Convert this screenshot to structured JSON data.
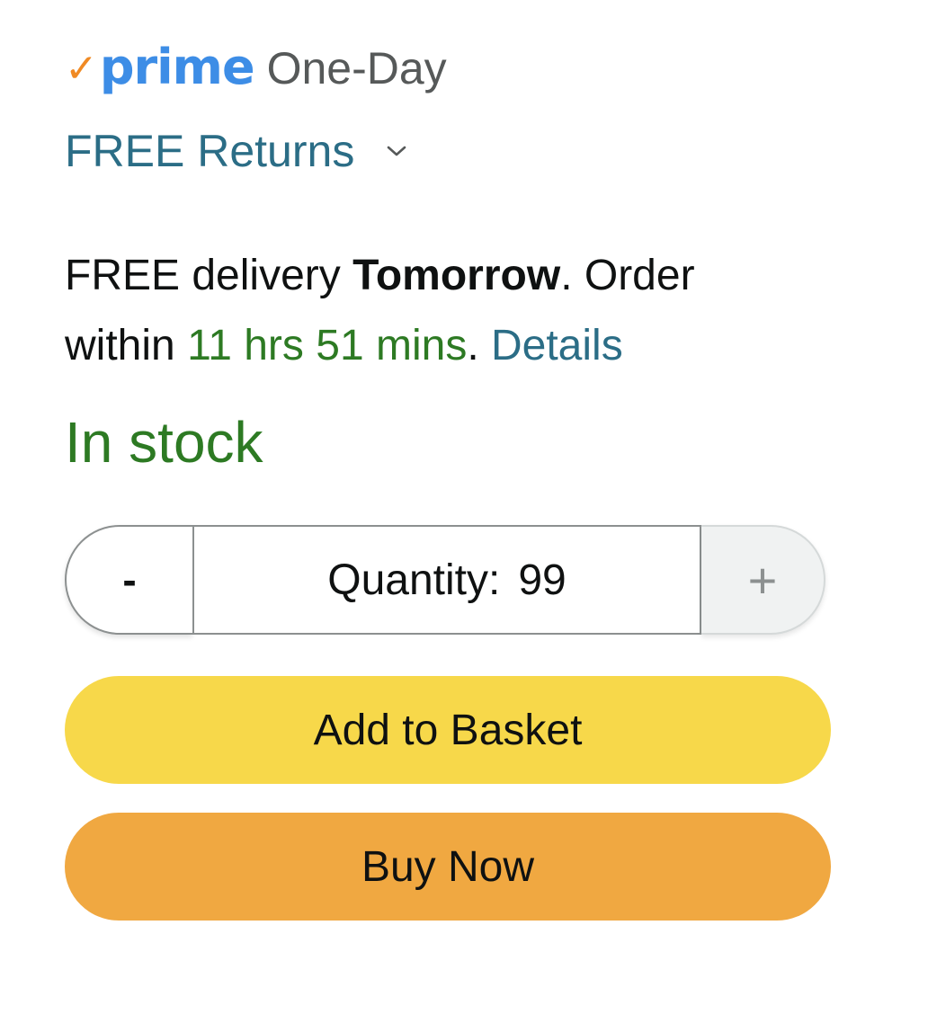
{
  "prime": {
    "check_glyph": "✓",
    "logo_word": "prime",
    "speed": "One-Day"
  },
  "returns": {
    "label": "FREE Returns",
    "chevron_icon": "chevron-down-icon"
  },
  "delivery": {
    "prefix": "FREE delivery ",
    "day": "Tomorrow",
    "after_day": ". Order",
    "within": "within ",
    "countdown": "11 hrs 51 mins",
    "period": ". ",
    "details_link": "Details"
  },
  "stock": {
    "status": "In stock"
  },
  "quantity": {
    "minus_label": "-",
    "label": "Quantity:",
    "value": "99",
    "plus_label": "+"
  },
  "actions": {
    "add_to_basket": "Add to Basket",
    "buy_now": "Buy Now"
  },
  "colors": {
    "prime_blue": "#3d8de6",
    "prime_check_orange": "#f08a24",
    "link_teal": "#2b6d86",
    "stock_green": "#2d7a23",
    "add_to_basket_yellow": "#f7d84a",
    "buy_now_orange": "#f0a841"
  }
}
